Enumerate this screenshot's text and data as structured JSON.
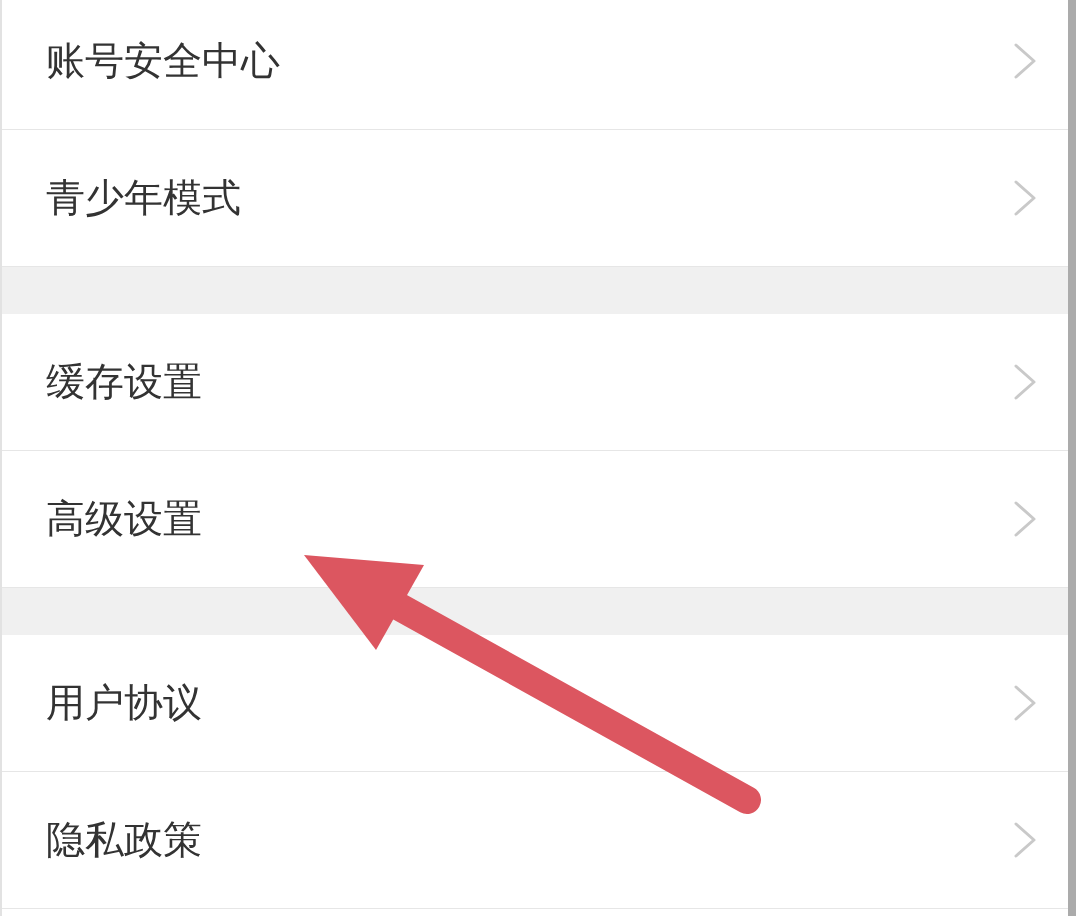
{
  "settings_groups": [
    {
      "items": [
        {
          "label": "账号安全中心"
        },
        {
          "label": "青少年模式"
        }
      ]
    },
    {
      "items": [
        {
          "label": "缓存设置"
        },
        {
          "label": "高级设置"
        }
      ]
    },
    {
      "items": [
        {
          "label": "用户协议"
        },
        {
          "label": "隐私政策"
        }
      ]
    }
  ],
  "annotation": {
    "kind": "arrow"
  }
}
